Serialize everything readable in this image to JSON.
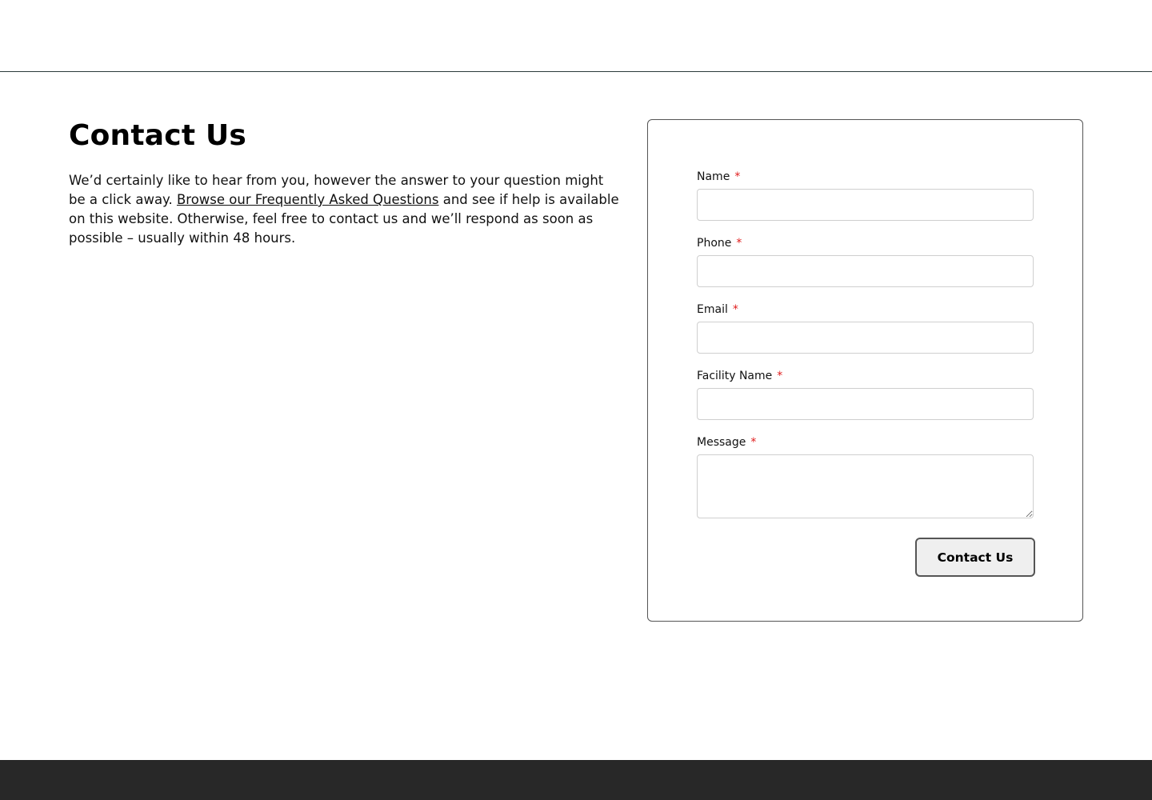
{
  "page": {
    "title": "Contact Us",
    "intro_before": "We’d certainly like to hear from you, however the answer to your question might be a click away. ",
    "intro_link": "Browse our Frequently Asked Questions",
    "intro_after": " and see if help is available on this website. Otherwise, feel free to contact us and we’ll respond as soon as possible – usually within 48 hours."
  },
  "form": {
    "fields": [
      {
        "label": "Name",
        "required_mark": "*",
        "value": ""
      },
      {
        "label": "Phone",
        "required_mark": "*",
        "value": ""
      },
      {
        "label": "Email",
        "required_mark": "*",
        "value": ""
      },
      {
        "label": "Facility Name",
        "required_mark": "*",
        "value": ""
      },
      {
        "label": "Message",
        "required_mark": "*",
        "value": ""
      }
    ],
    "submit_label": "Contact Us"
  },
  "colors": {
    "required": "#e01b1b",
    "footer": "#282828",
    "button_bg": "#efefef"
  }
}
